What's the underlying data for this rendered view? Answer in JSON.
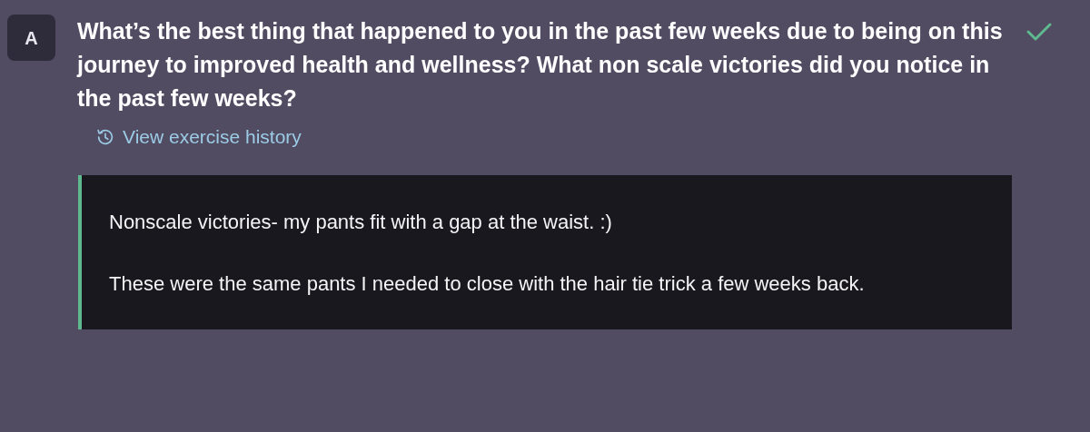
{
  "question": {
    "badge": "A",
    "text": "What’s the best thing that happened to you in the past few weeks due to being on this journey to improved health and wellness? What non scale victories did you notice in the past few weeks?",
    "checked": true
  },
  "history_link": {
    "label": "View exercise history"
  },
  "answer": {
    "paragraphs": [
      "Nonscale victories- my pants fit with a gap at the waist. :)",
      "These were the same pants I needed to close with the hair tie trick a few weeks back."
    ]
  }
}
